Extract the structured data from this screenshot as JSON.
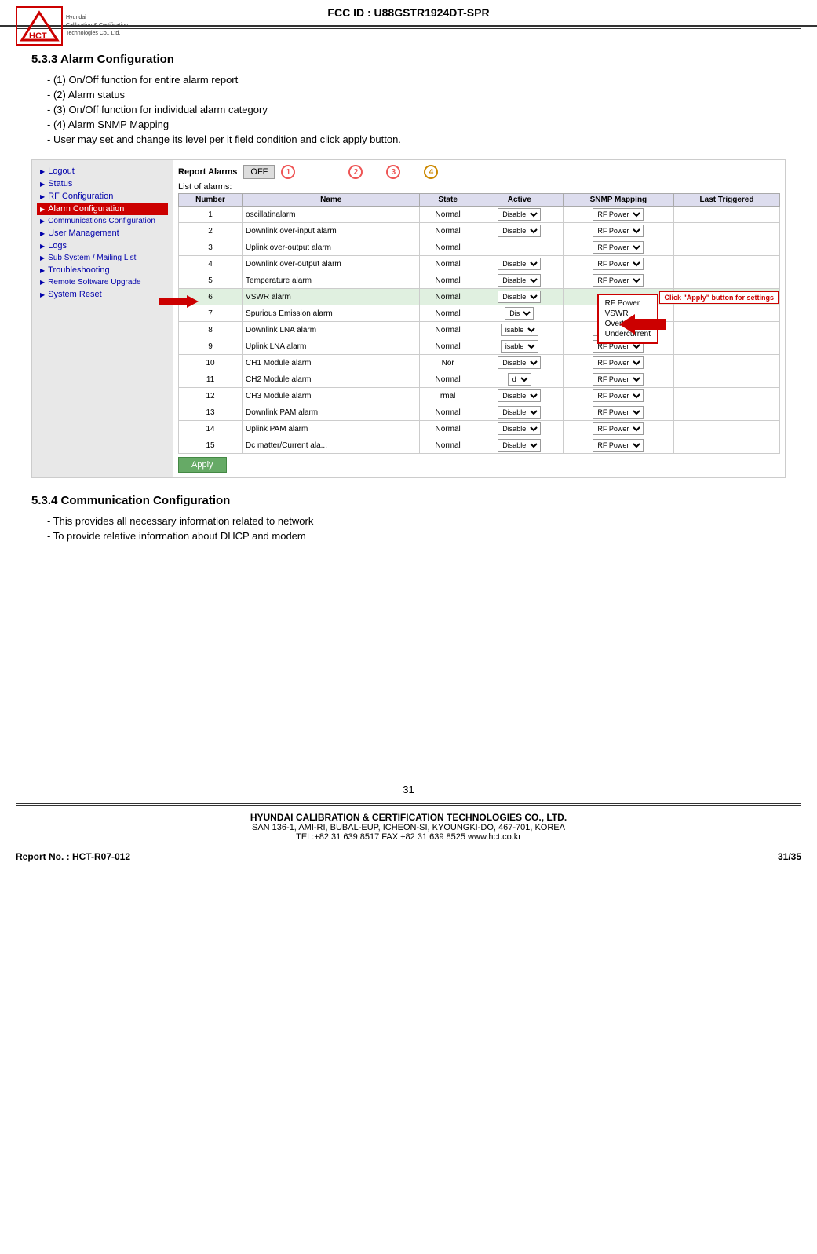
{
  "header": {
    "fcc_id": "FCC ID : U88GSTR1924DT-SPR",
    "logo_letters": "HCT",
    "logo_subtext": "Hyundai\nCalibration & Certification\nTechnologies Co., Ltd."
  },
  "section533": {
    "title": "5.3.3 Alarm Configuration",
    "items": [
      "- (1) On/Off function for entire alarm report",
      "- (2) Alarm status",
      "- (3) On/Off function for individual alarm category",
      "- (4) Alarm SNMP Mapping",
      "- User may set and change its level per it field condition and click apply button."
    ]
  },
  "screenshot": {
    "sidebar": {
      "items": [
        {
          "label": "Logout",
          "active": false
        },
        {
          "label": "Status",
          "active": false
        },
        {
          "label": "RF Configuration",
          "active": false
        },
        {
          "label": "Alarm Configuration",
          "active": true
        },
        {
          "label": "Communications Configuration",
          "active": false
        },
        {
          "label": "User Management",
          "active": false
        },
        {
          "label": "Logs",
          "active": false
        },
        {
          "label": "Sub System / Mailing List",
          "active": false
        },
        {
          "label": "Troubleshooting",
          "active": false
        },
        {
          "label": "Remote Software Upgrade",
          "active": false
        },
        {
          "label": "System Reset",
          "active": false
        }
      ]
    },
    "report_alarms_label": "Report Alarms",
    "off_label": "OFF",
    "circle_labels": [
      "1",
      "2",
      "3",
      "4"
    ],
    "list_of_alarms": "List of alarms:",
    "table_headers": [
      "Number",
      "Name",
      "State",
      "Active",
      "SNMP Mapping",
      "Last Triggered"
    ],
    "table_rows": [
      {
        "num": "1",
        "name": "oscillatinalarm",
        "state": "Normal",
        "active": "Disable",
        "snmp": "RF Power"
      },
      {
        "num": "2",
        "name": "Downlink over-input alarm",
        "state": "Normal",
        "active": "Disable",
        "snmp": "RF Power"
      },
      {
        "num": "3",
        "name": "Uplink over-output alarm",
        "state": "Normal",
        "active": "",
        "snmp": "RF Power"
      },
      {
        "num": "4",
        "name": "Downlink over-output alarm",
        "state": "Normal",
        "active": "Disable",
        "snmp": "RF Power"
      },
      {
        "num": "5",
        "name": "Temperature alarm",
        "state": "Normal",
        "active": "Disable",
        "snmp": "RF Power"
      },
      {
        "num": "6",
        "name": "VSWR alarm",
        "state": "Normal",
        "active": "Disable",
        "snmp": ""
      },
      {
        "num": "7",
        "name": "Spurious Emission alarm",
        "state": "Normal",
        "active": "Dis",
        "snmp": ""
      },
      {
        "num": "8",
        "name": "Downlink LNA alarm",
        "state": "Normal",
        "active": "isable",
        "snmp": "RF Power"
      },
      {
        "num": "9",
        "name": "Uplink LNA alarm",
        "state": "Normal",
        "active": "isable",
        "snmp": "RF Power"
      },
      {
        "num": "10",
        "name": "CH1 Module alarm",
        "state": "Nor",
        "active": "Disable",
        "snmp": "RF Power"
      },
      {
        "num": "11",
        "name": "CH2 Module alarm",
        "state": "Normal",
        "active": "d",
        "snmp": "RF Power"
      },
      {
        "num": "12",
        "name": "CH3 Module alarm",
        "state": "rmal",
        "active": "Disable",
        "snmp": "RF Power"
      },
      {
        "num": "13",
        "name": "Downlink PAM alarm",
        "state": "Normal",
        "active": "Disable",
        "snmp": "RF Power"
      },
      {
        "num": "14",
        "name": "Uplink PAM alarm",
        "state": "Normal",
        "active": "Disable",
        "snmp": "RF Power"
      },
      {
        "num": "15",
        "name": "Dc matter/Current ala...",
        "state": "Normal",
        "active": "Disable",
        "snmp": "RF Power"
      }
    ],
    "dropdown_options": [
      "RF Power",
      "VSWR",
      "Overtemp",
      "Undercurrent"
    ],
    "annotation_text": "Click \"Apply\" button for settings",
    "apply_label": "Apply"
  },
  "section534": {
    "title": "5.3.4 Communication Configuration",
    "items": [
      "- This provides all necessary information related to network",
      "- To provide relative information about DHCP and modem"
    ]
  },
  "footer": {
    "page_number": "31",
    "company": "HYUNDAI CALIBRATION & CERTIFICATION TECHNOLOGIES CO., LTD.",
    "address": "SAN 136-1, AMI-RI, BUBAL-EUP, ICHEON-SI, KYOUNGKI-DO, 467-701, KOREA",
    "contact": "TEL:+82 31 639 8517    FAX:+82 31 639 8525    www.hct.co.kr",
    "report_left": "Report No. :  HCT-R07-012",
    "report_right": "31/35"
  }
}
